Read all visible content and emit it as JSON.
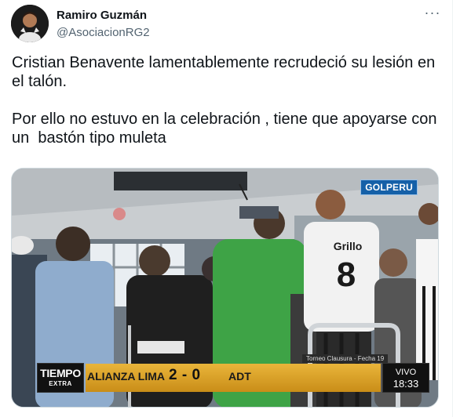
{
  "author": {
    "display_name": "Ramiro Guzmán",
    "handle": "@AsociacionRG2"
  },
  "more_label": "···",
  "tweet_text": "Cristian Benavente lamentablemente recrudeció su lesión en el talón.\n\nPor ello no estuvo en la celebración , tiene que apoyarse con un  bastón tipo muleta",
  "media": {
    "watermark": "GOLPERU",
    "broadcast_logo_top": "TIEMPO",
    "broadcast_logo_bottom": "EXTRA",
    "home_team": "ALIANZA LIMA",
    "score": "2 - 0",
    "away_team": "ADT",
    "tournament": "Torneo Clausura - Fecha 19",
    "live_label": "VIVO",
    "clock": "18:33",
    "jersey_name": "Grillo",
    "jersey_number": "8"
  },
  "colors": {
    "text_primary": "#0f1419",
    "text_secondary": "#536471",
    "score_bar_gold": "#e0a82e",
    "golperu_blue": "#1560a8"
  }
}
